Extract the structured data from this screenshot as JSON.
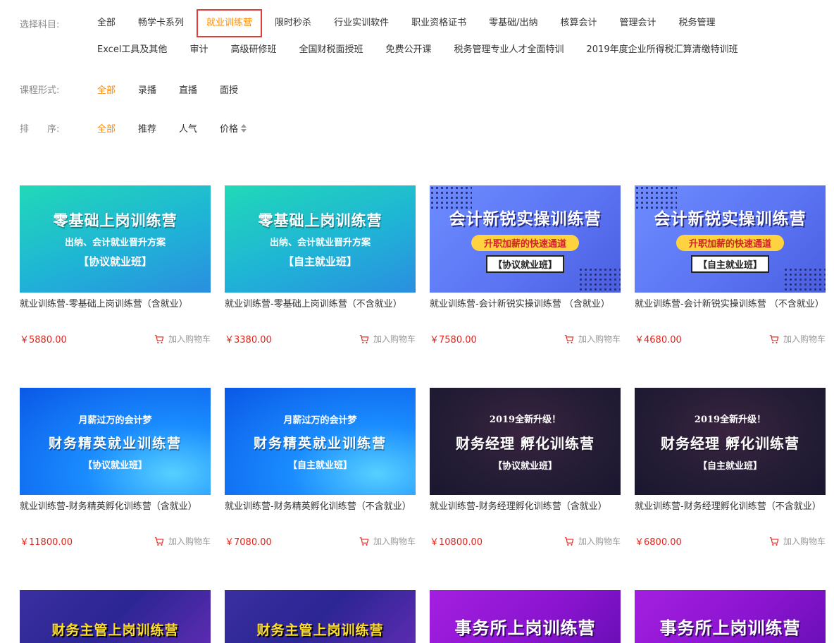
{
  "filters": {
    "subject": {
      "label": "选择科目:",
      "items": [
        "全部",
        "畅学卡系列",
        "就业训练营",
        "限时秒杀",
        "行业实训软件",
        "职业资格证书",
        "零基础/出纳",
        "核算会计",
        "管理会计",
        "税务管理",
        "Excel工具及其他",
        "审计",
        "高级研修班",
        "全国财税面授班",
        "免费公开课",
        "税务管理专业人才全面特训",
        "2019年度企业所得税汇算清缴特训班"
      ],
      "active": "就业训练营"
    },
    "format": {
      "label": "课程形式:",
      "items": [
        "全部",
        "录播",
        "直播",
        "面授"
      ],
      "active": "全部"
    },
    "sort": {
      "label": "排　　序:",
      "items": [
        "全部",
        "推荐",
        "人气",
        "价格"
      ],
      "active": "全部"
    }
  },
  "courses": [
    {
      "style": "teal",
      "banner": {
        "top": "",
        "main": "零基础上岗训练营",
        "sub": "出纳、会计就业晋升方案",
        "tag": "【协议就业班】"
      },
      "title": "就业训练营-零基础上岗训练营（含就业）",
      "price": "￥5880.00",
      "cart": "加入购物车"
    },
    {
      "style": "teal",
      "banner": {
        "top": "",
        "main": "零基础上岗训练营",
        "sub": "出纳、会计就业晋升方案",
        "tag": "【自主就业班】"
      },
      "title": "就业训练营-零基础上岗训练营（不含就业）",
      "price": "￥3380.00",
      "cart": "加入购物车"
    },
    {
      "style": "purple",
      "banner": {
        "top": "",
        "main": "会计新锐实操训练营",
        "sub": "升职加薪的快速通道",
        "tag": "【协议就业班】"
      },
      "title": "就业训练营-会计新锐实操训练营 （含就业）",
      "price": "￥7580.00",
      "cart": "加入购物车"
    },
    {
      "style": "purple",
      "banner": {
        "top": "",
        "main": "会计新锐实操训练营",
        "sub": "升职加薪的快速通道",
        "tag": "【自主就业班】"
      },
      "title": "就业训练营-会计新锐实操训练营 （不含就业）",
      "price": "￥4680.00",
      "cart": "加入购物车"
    },
    {
      "style": "blue",
      "banner": {
        "top": "月薪过万的会计梦",
        "main": "财务精英就业训练营",
        "sub": "",
        "tag": "【协议就业班】"
      },
      "title": "就业训练营-财务精英孵化训练营（含就业）",
      "price": "￥11800.00",
      "cart": "加入购物车"
    },
    {
      "style": "blue",
      "banner": {
        "top": "月薪过万的会计梦",
        "main": "财务精英就业训练营",
        "sub": "",
        "tag": "【自主就业班】"
      },
      "title": "就业训练营-财务精英孵化训练营（不含就业）",
      "price": "￥7080.00",
      "cart": "加入购物车"
    },
    {
      "style": "dark",
      "banner": {
        "top": "2019全新升级！",
        "main": "财务经理 孵化训练营",
        "sub": "",
        "tag": "【协议就业班】"
      },
      "title": "就业训练营-财务经理孵化训练营（含就业）",
      "price": "￥10800.00",
      "cart": "加入购物车"
    },
    {
      "style": "dark",
      "banner": {
        "top": "2019全新升级！",
        "main": "财务经理 孵化训练营",
        "sub": "",
        "tag": "【自主就业班】"
      },
      "title": "就业训练营-财务经理孵化训练营（不含就业）",
      "price": "￥6800.00",
      "cart": "加入购物车"
    },
    {
      "style": "navy",
      "banner": {
        "top": "",
        "main": "财务主管上岗训练营",
        "sub": "",
        "tag": ""
      },
      "title": "",
      "price": "",
      "cart": ""
    },
    {
      "style": "navy",
      "banner": {
        "top": "",
        "main": "财务主管上岗训练营",
        "sub": "",
        "tag": ""
      },
      "title": "",
      "price": "",
      "cart": ""
    },
    {
      "style": "violet",
      "banner": {
        "top": "",
        "main": "事务所上岗训练营",
        "sub": "",
        "tag": ""
      },
      "title": "",
      "price": "",
      "cart": ""
    },
    {
      "style": "violet",
      "banner": {
        "top": "",
        "main": "事务所上岗训练营",
        "sub": "",
        "tag": ""
      },
      "title": "",
      "price": "",
      "cart": ""
    }
  ],
  "colors": {
    "accent": "#ff8a00",
    "price": "#e2231a",
    "highlight_box": "#e23b3b"
  },
  "icons": {
    "cart": "shopping-cart-icon",
    "sort": "sort-arrows-icon"
  }
}
